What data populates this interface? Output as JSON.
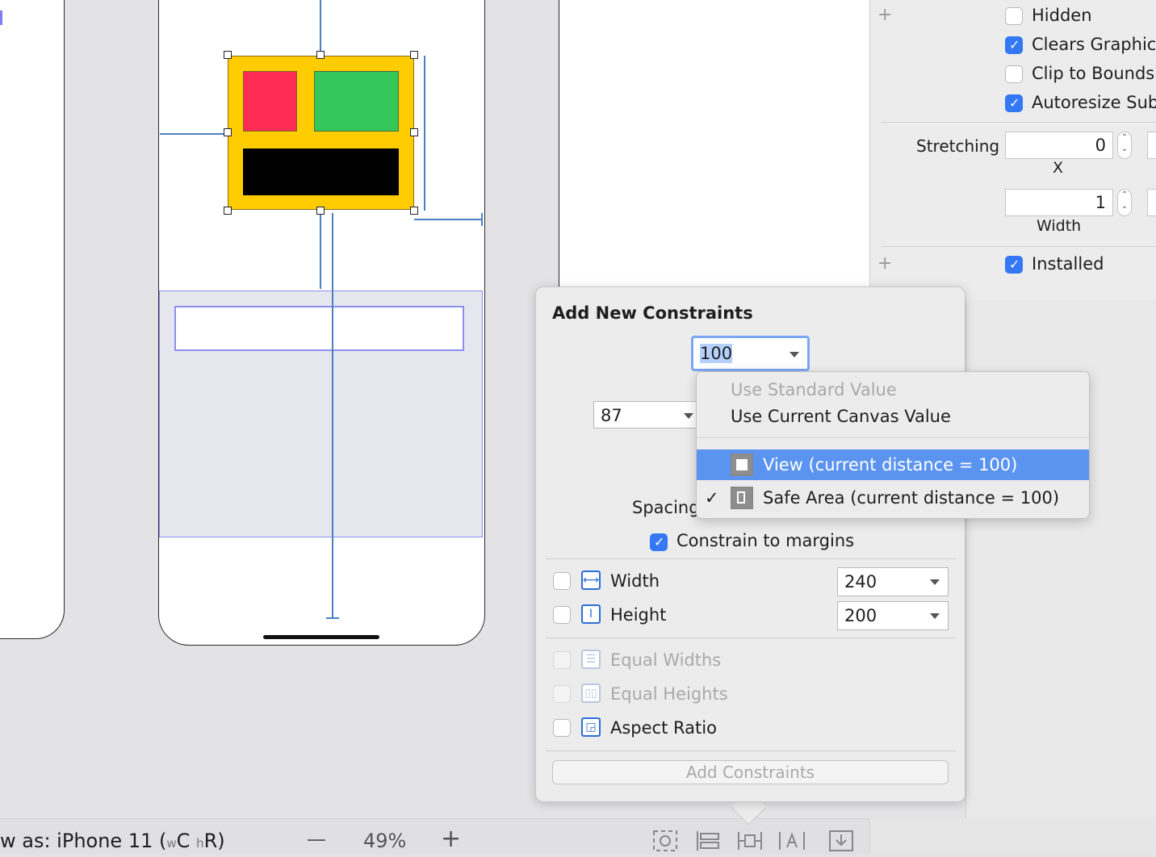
{
  "inspector": {
    "hidden_label": "Hidden",
    "clears_graphics_label": "Clears Graphic",
    "clip_to_bounds_label": "Clip to Bounds",
    "autoresize_label": "Autoresize Sub",
    "stretching_label": "Stretching",
    "stretch_x_value": "0",
    "stretch_x_caption": "X",
    "stretch_w_value": "1",
    "stretch_w_caption": "Width",
    "installed_label": "Installed"
  },
  "popover": {
    "title": "Add New Constraints",
    "top_value": "100",
    "left_value": "87",
    "spacing_label": "Spacing",
    "constrain_margins_label": "Constrain to margins",
    "width_label": "Width",
    "width_value": "240",
    "height_label": "Height",
    "height_value": "200",
    "equal_widths_label": "Equal Widths",
    "equal_heights_label": "Equal Heights",
    "aspect_ratio_label": "Aspect Ratio",
    "add_button": "Add Constraints"
  },
  "menu": {
    "use_standard": "Use Standard Value",
    "use_canvas": "Use Current Canvas Value",
    "view_item": "View (current distance = 100)",
    "safe_area_item": "Safe Area (current distance = 100)",
    "checkmark": "✓"
  },
  "bottom_bar": {
    "view_as_prefix": "w as: iPhone 11 (",
    "w_small": "w",
    "w_big": "C",
    "h_small": "h",
    "h_big": "R)",
    "zoom_minus": "—",
    "zoom": "49%",
    "zoom_plus": "+"
  },
  "colors": {
    "accent": "#3478f6",
    "menu_highlight": "#5b94f0",
    "yellow_view": "#ffcc00",
    "red_view": "#ff2d55",
    "green_view": "#34c759"
  }
}
